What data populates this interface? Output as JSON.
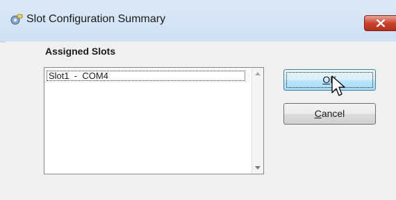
{
  "window": {
    "title": "Slot Configuration Summary",
    "icon": "gear-app-icon",
    "close_icon": "close-icon"
  },
  "assigned_slots": {
    "label": "Assigned Slots",
    "items": [
      "Slot1  -  COM4"
    ]
  },
  "buttons": {
    "ok": {
      "mnemonic": "O",
      "rest": "K"
    },
    "cancel": {
      "mnemonic": "C",
      "rest": "ancel"
    }
  },
  "colors": {
    "close_button": "#c8432f",
    "default_button_border": "#3c7fb1"
  }
}
